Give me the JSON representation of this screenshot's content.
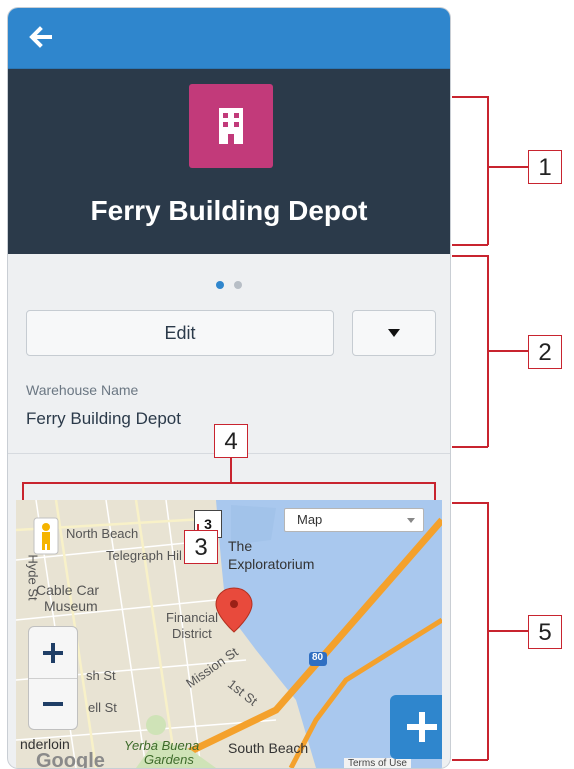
{
  "app": {
    "title": "Ferry Building Depot",
    "colors": {
      "header_bar": "#2f86cd",
      "header_bg": "#2b3a4a",
      "logo": "#c23a7a",
      "annotation": "#c8242f"
    }
  },
  "nav": {
    "back_icon": "arrow-left-icon"
  },
  "record": {
    "icon": "building-icon",
    "title": "Ferry Building Depot"
  },
  "pager": {
    "active": 1,
    "total": 2
  },
  "actions": {
    "edit_label": "Edit",
    "more_icon": "caret-down-icon"
  },
  "fields": [
    {
      "label": "Warehouse Name",
      "value": "Ferry Building Depot"
    }
  ],
  "map": {
    "type_selector": "Map",
    "marker_count": "3",
    "labels": {
      "north_beach": "North Beach",
      "telegraph": "Telegraph Hil",
      "the": "The",
      "exploratorium": "Exploratorium",
      "hyde": "Hyde St",
      "cable_car": "Cable Car",
      "museum": "Museum",
      "financial": "Financial",
      "district": "District",
      "bush": "sh St",
      "mission": "Mission St",
      "first": "1st St",
      "pine": "ell St",
      "highway": "80",
      "tenderloin": "nderloin",
      "yerba1": "Yerba Buena",
      "yerba2": "Gardens",
      "south_beach": "South Beach",
      "google": "Google",
      "terms": "Terms of Use"
    },
    "zoom_in_icon": "plus-icon",
    "zoom_out_icon": "minus-icon",
    "fab_icon": "plus-icon"
  },
  "annotations": [
    "1",
    "2",
    "3",
    "4",
    "5"
  ]
}
